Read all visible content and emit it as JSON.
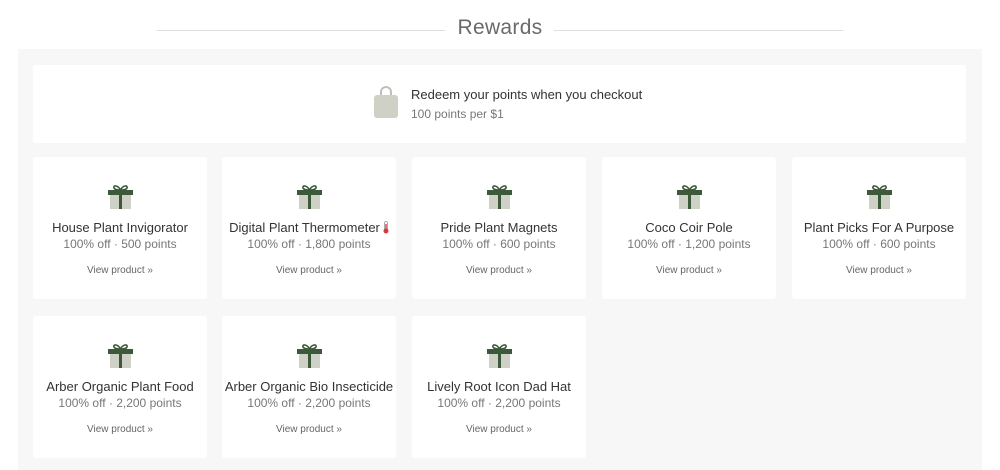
{
  "header": {
    "title": "Rewards"
  },
  "banner": {
    "icon": "shopping-bag-icon",
    "title": "Redeem your points when you checkout",
    "subtitle": "100 points per $1"
  },
  "colors": {
    "gift_green": "#3c5a3a",
    "gift_box": "#cfd1c6",
    "bag": "#cfd1c6"
  },
  "rewards": [
    {
      "name": "House Plant Invigorator",
      "points": "100% off · 500 points",
      "link": "View product »",
      "icon": "gift-icon"
    },
    {
      "name": "Digital Plant Thermometer",
      "points": "100% off · 1,800 points",
      "link": "View product »",
      "icon": "gift-icon",
      "emoji": "thermometer-icon"
    },
    {
      "name": "Pride Plant Magnets",
      "points": "100% off · 600 points",
      "link": "View product »",
      "icon": "gift-icon"
    },
    {
      "name": "Coco Coir Pole",
      "points": "100% off · 1,200 points",
      "link": "View product »",
      "icon": "gift-icon"
    },
    {
      "name": "Plant Picks For A Purpose",
      "points": "100% off · 600 points",
      "link": "View product »",
      "icon": "gift-icon"
    },
    {
      "name": "Arber Organic Plant Food",
      "points": "100% off · 2,200 points",
      "link": "View product »",
      "icon": "gift-icon"
    },
    {
      "name": "Arber Organic Bio Insecticide",
      "points": "100% off · 2,200 points",
      "link": "View product »",
      "icon": "gift-icon"
    },
    {
      "name": "Lively Root Icon Dad Hat",
      "points": "100% off · 2,200 points",
      "link": "View product »",
      "icon": "gift-icon"
    }
  ]
}
